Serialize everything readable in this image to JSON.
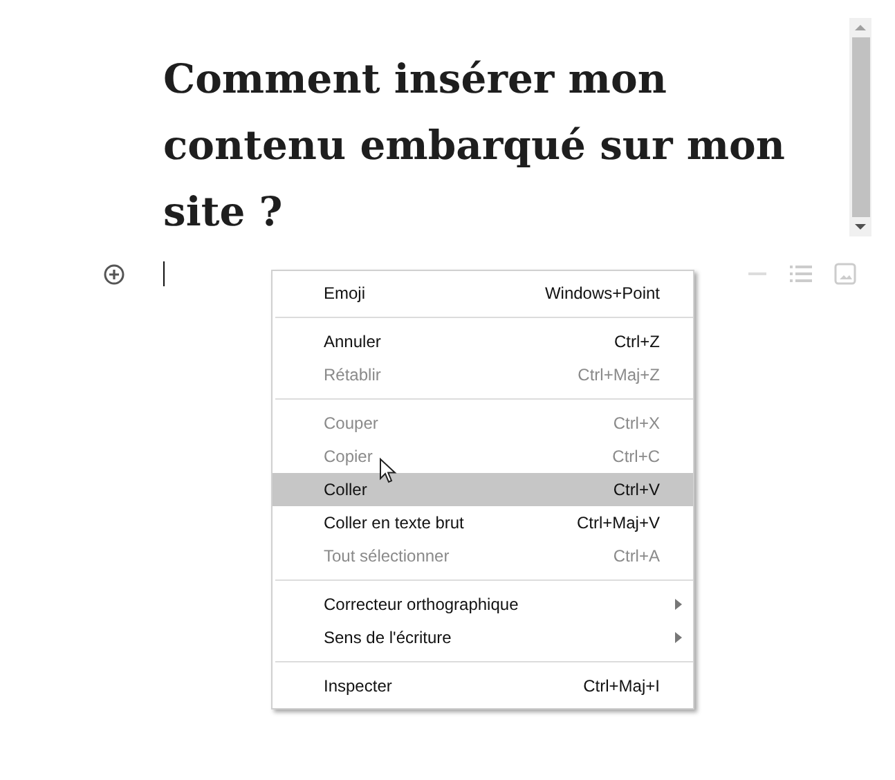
{
  "title": "Comment insérer mon contenu embarqué sur mon site ?",
  "context_menu": {
    "groups": [
      [
        {
          "label": "Emoji",
          "shortcut": "Windows+Point",
          "disabled": false,
          "selected": false,
          "submenu": false
        }
      ],
      [
        {
          "label": "Annuler",
          "shortcut": "Ctrl+Z",
          "disabled": false,
          "selected": false,
          "submenu": false
        },
        {
          "label": "Rétablir",
          "shortcut": "Ctrl+Maj+Z",
          "disabled": true,
          "selected": false,
          "submenu": false
        }
      ],
      [
        {
          "label": "Couper",
          "shortcut": "Ctrl+X",
          "disabled": true,
          "selected": false,
          "submenu": false
        },
        {
          "label": "Copier",
          "shortcut": "Ctrl+C",
          "disabled": true,
          "selected": false,
          "submenu": false
        },
        {
          "label": "Coller",
          "shortcut": "Ctrl+V",
          "disabled": false,
          "selected": true,
          "submenu": false
        },
        {
          "label": "Coller en texte brut",
          "shortcut": "Ctrl+Maj+V",
          "disabled": false,
          "selected": false,
          "submenu": false
        },
        {
          "label": "Tout sélectionner",
          "shortcut": "Ctrl+A",
          "disabled": true,
          "selected": false,
          "submenu": false
        }
      ],
      [
        {
          "label": "Correcteur orthographique",
          "disabled": false,
          "selected": false,
          "submenu": true
        },
        {
          "label": "Sens de l'écriture",
          "disabled": false,
          "selected": false,
          "submenu": true
        }
      ],
      [
        {
          "label": "Inspecter",
          "shortcut": "Ctrl+Maj+I",
          "disabled": false,
          "selected": false,
          "submenu": false
        }
      ]
    ]
  }
}
